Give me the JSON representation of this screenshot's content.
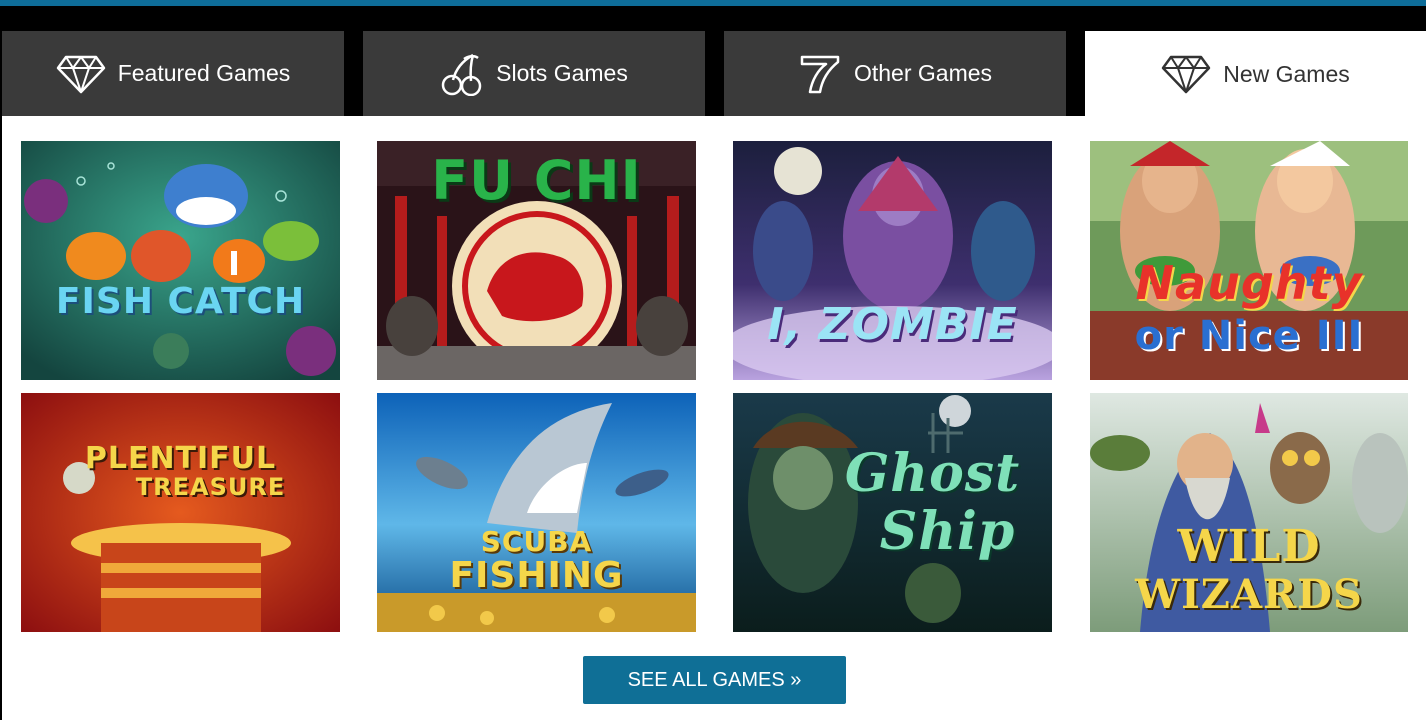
{
  "tabs": [
    {
      "label": "Featured Games",
      "icon": "diamond-icon",
      "active": false
    },
    {
      "label": "Slots Games",
      "icon": "cherries-icon",
      "active": false
    },
    {
      "label": "Other Games",
      "icon": "seven-icon",
      "active": false
    },
    {
      "label": "New Games",
      "icon": "diamond-icon",
      "active": true
    }
  ],
  "games": [
    {
      "title_line1": "FISH",
      "title_line2": "CATCH"
    },
    {
      "title_line1": "FU CHI",
      "title_line2": ""
    },
    {
      "title_line1": "I, ZOMBIE",
      "title_line2": ""
    },
    {
      "title_line1": "Naughty",
      "title_line2": "or Nice III"
    },
    {
      "title_line1": "PLENTIFUL",
      "title_line2": "TREASURE"
    },
    {
      "title_line1": "SCUBA",
      "title_line2": "FISHING"
    },
    {
      "title_line1": "Ghost",
      "title_line2": "Ship"
    },
    {
      "title_line1": "WILD",
      "title_line2": "WIZARDS"
    }
  ],
  "see_all_label": "SEE ALL GAMES »",
  "colors": {
    "accent": "#0e6d99",
    "tab_bg": "#3a3a3a",
    "active_tab_bg": "#ffffff"
  }
}
